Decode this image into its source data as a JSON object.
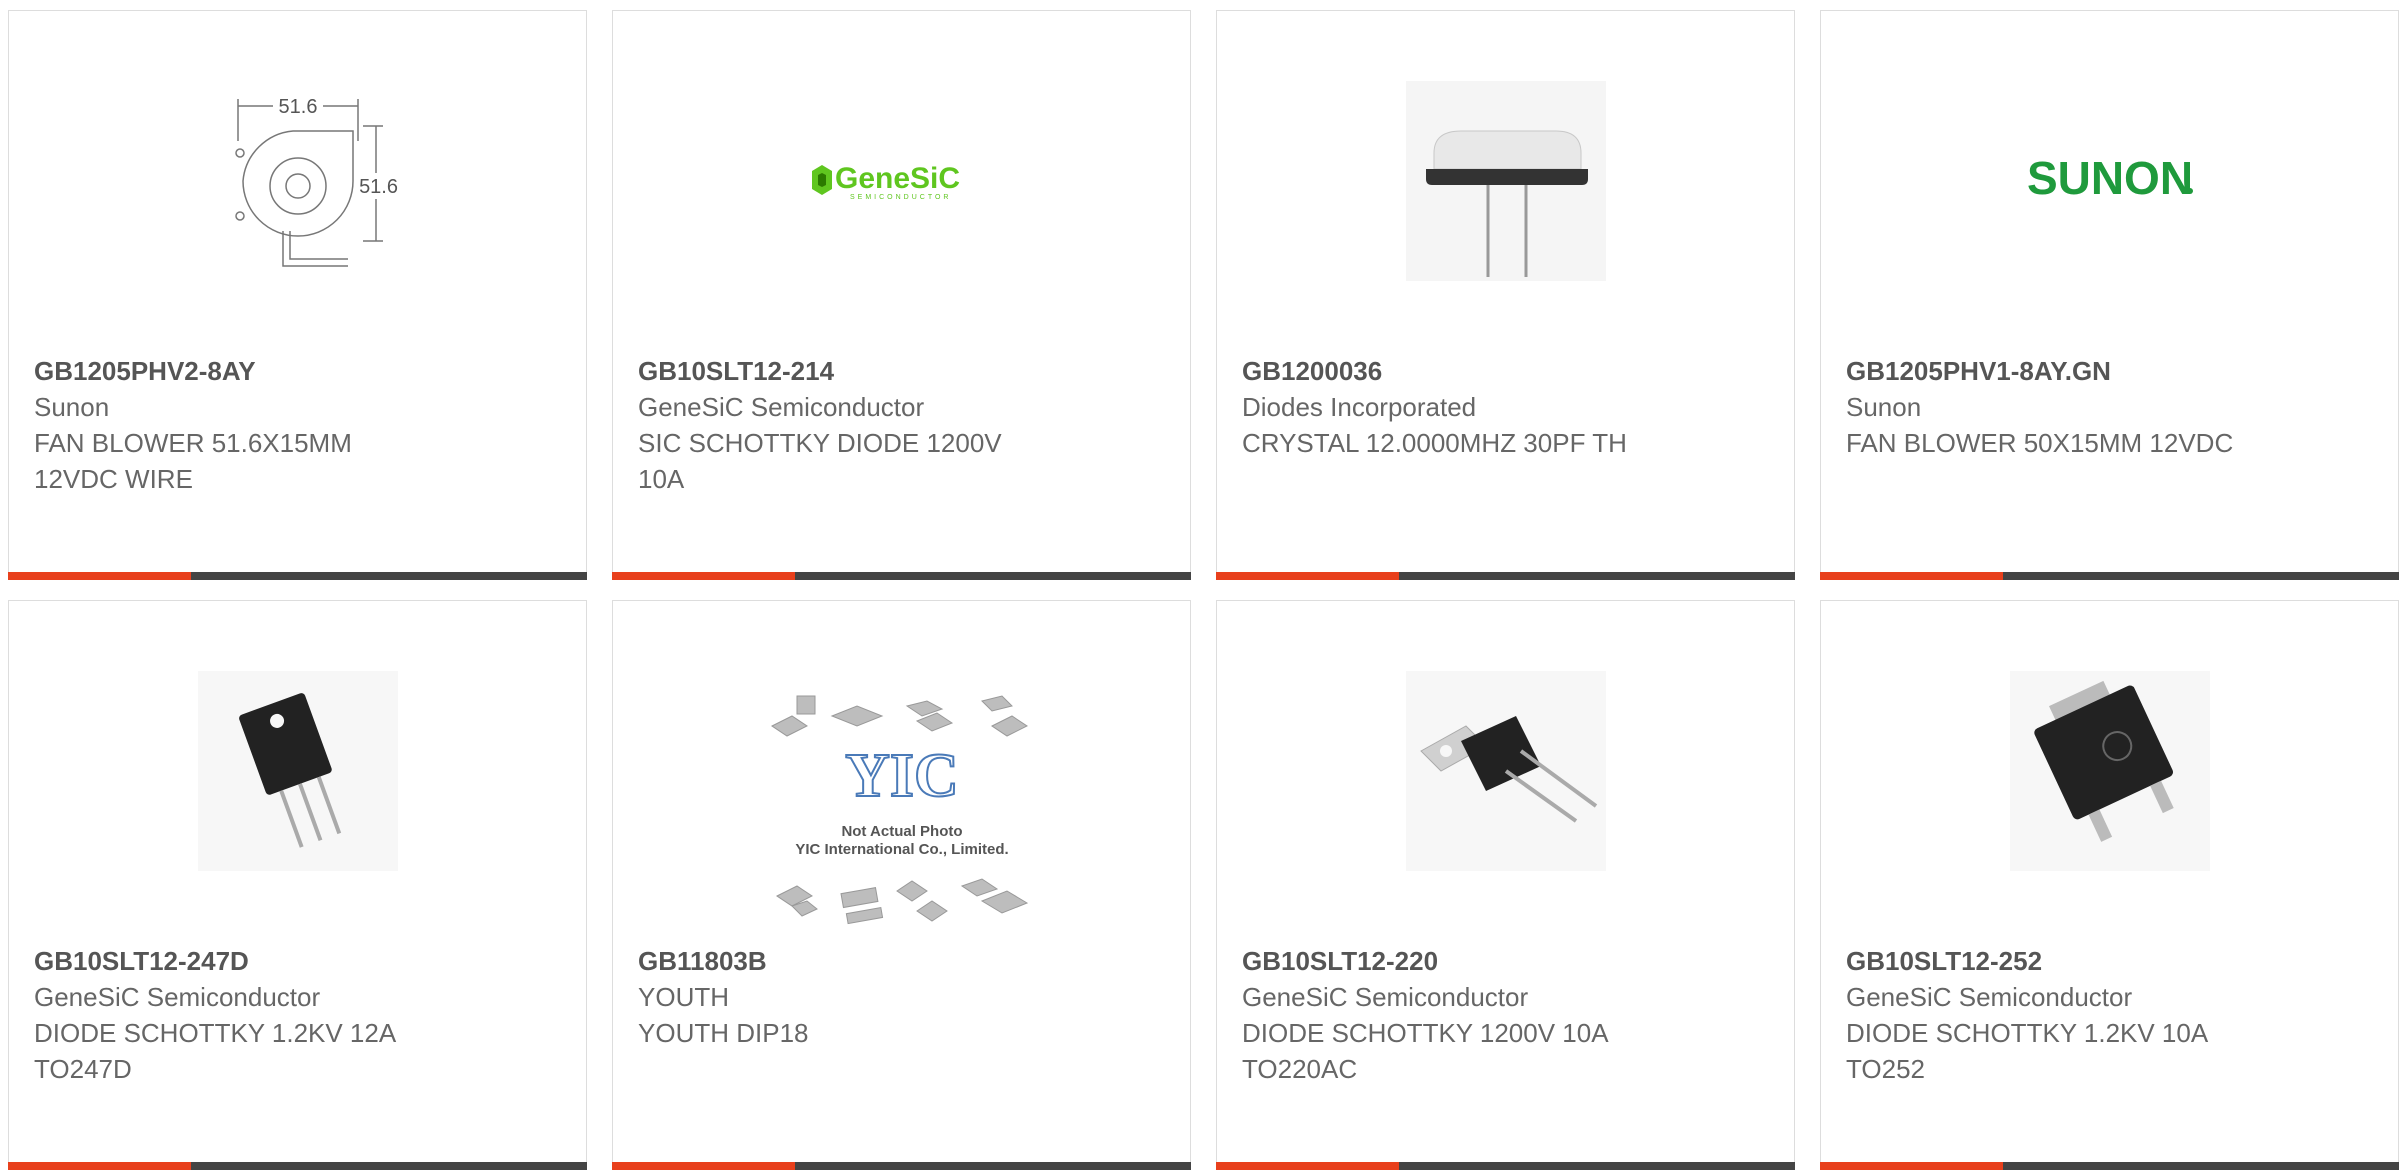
{
  "colors": {
    "accent": "#e8401c",
    "bar": "#444444",
    "text": "#666666"
  },
  "products": [
    {
      "part": "GB1205PHV2-8AY",
      "maker": "Sunon",
      "desc": "FAN BLOWER 51.6X15MM 12VDC WIRE",
      "image": "fan-blower-drawing",
      "dim_top": "51.6",
      "dim_side": "51.6"
    },
    {
      "part": "GB10SLT12-214",
      "maker": "GeneSiC Semiconductor",
      "desc": "SIC SCHOTTKY DIODE 1200V 10A",
      "image": "genesic-logo",
      "logo_text": "GeneSiC",
      "logo_sub": "SEMICONDUCTOR"
    },
    {
      "part": "GB1200036",
      "maker": "Diodes Incorporated",
      "desc": "CRYSTAL 12.0000MHZ 30PF TH",
      "image": "crystal-oscillator"
    },
    {
      "part": "GB1205PHV1-8AY.GN",
      "maker": "Sunon",
      "desc": "FAN BLOWER 50X15MM 12VDC",
      "image": "sunon-logo",
      "logo_text": "SUNON"
    },
    {
      "part": "GB10SLT12-247D",
      "maker": "GeneSiC Semiconductor",
      "desc": "DIODE SCHOTTKY 1.2KV 12A TO247D",
      "image": "to247-package"
    },
    {
      "part": "GB11803B",
      "maker": "YOUTH",
      "desc": "YOUTH DIP18",
      "image": "placeholder-photo",
      "ph_line1": "Not Actual Photo",
      "ph_line2": "YIC International Co., Limited."
    },
    {
      "part": "GB10SLT12-220",
      "maker": "GeneSiC Semiconductor",
      "desc": "DIODE SCHOTTKY 1200V 10A TO220AC",
      "image": "to220-package"
    },
    {
      "part": "GB10SLT12-252",
      "maker": "GeneSiC Semiconductor",
      "desc": "DIODE SCHOTTKY 1.2KV 10A TO252",
      "image": "to252-package"
    }
  ]
}
